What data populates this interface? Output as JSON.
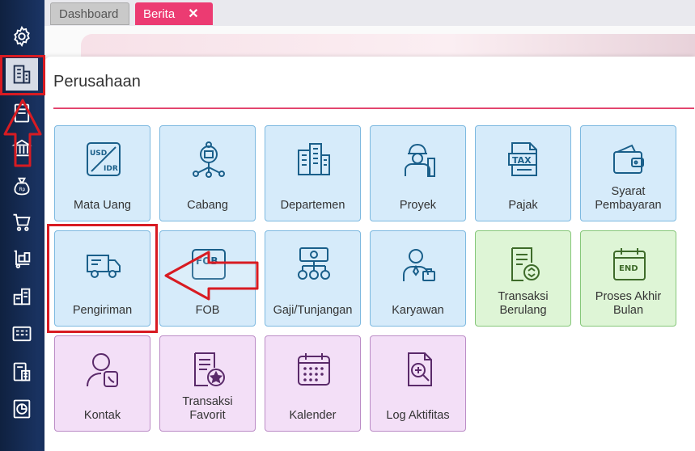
{
  "tabs": [
    {
      "label": "Dashboard",
      "active": false
    },
    {
      "label": "Berita",
      "active": true,
      "close": "✕"
    }
  ],
  "page": {
    "title": "Perusahaan"
  },
  "tiles": [
    {
      "label": "Mata Uang",
      "icon": "currency-exchange-icon",
      "color": "blue"
    },
    {
      "label": "Cabang",
      "icon": "branch-network-icon",
      "color": "blue"
    },
    {
      "label": "Departemen",
      "icon": "department-building-icon",
      "color": "blue"
    },
    {
      "label": "Proyek",
      "icon": "project-worker-icon",
      "color": "blue"
    },
    {
      "label": "Pajak",
      "icon": "tax-document-icon",
      "color": "blue"
    },
    {
      "label": "Syarat\nPembayaran",
      "icon": "payment-wallet-icon",
      "color": "blue"
    },
    {
      "label": "Pengiriman",
      "icon": "delivery-truck-icon",
      "color": "blue"
    },
    {
      "label": "FOB",
      "icon": "fob-icon",
      "color": "blue"
    },
    {
      "label": "Gaji/Tunjangan",
      "icon": "salary-icon",
      "color": "blue"
    },
    {
      "label": "Karyawan",
      "icon": "employee-icon",
      "color": "blue"
    },
    {
      "label": "Transaksi\nBerulang",
      "icon": "recurring-transaction-icon",
      "color": "green"
    },
    {
      "label": "Proses Akhir\nBulan",
      "icon": "end-of-month-calendar-icon",
      "color": "green"
    },
    {
      "label": "Kontak",
      "icon": "contact-icon",
      "color": "purple"
    },
    {
      "label": "Transaksi\nFavorit",
      "icon": "favorite-transaction-icon",
      "color": "purple"
    },
    {
      "label": "Kalender",
      "icon": "calendar-icon",
      "color": "purple"
    },
    {
      "label": "Log Aktifitas",
      "icon": "activity-log-icon",
      "color": "purple"
    }
  ],
  "colors": {
    "accent": "#ec3b72",
    "sidebar": "#1b3566",
    "tile_icon": "#1a5f8a",
    "tile_icon_green": "#3e6b2a",
    "tile_icon_purple": "#5a2a6a",
    "annotation": "#d81b22"
  },
  "sidebar_icons": [
    "gear-icon",
    "company-building-icon",
    "ledger-icon",
    "bank-icon",
    "money-bag-icon",
    "shopping-cart-icon",
    "delivery-icon",
    "inventory-icon",
    "cash-register-icon",
    "tax-report-icon",
    "chart-icon"
  ]
}
